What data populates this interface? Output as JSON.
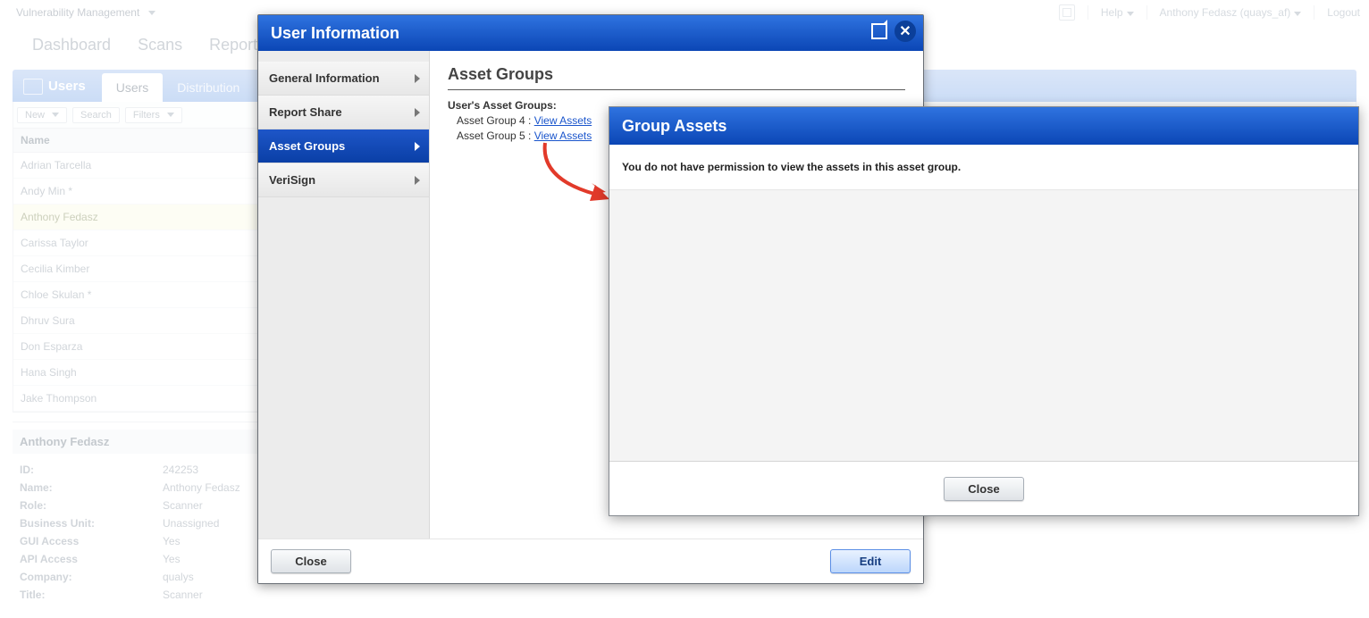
{
  "topbar": {
    "app_name": "Vulnerability Management",
    "help_label": "Help",
    "user_display": "Anthony Fedasz (quays_af)",
    "logout_label": "Logout"
  },
  "main_nav": {
    "items": [
      "Dashboard",
      "Scans",
      "Reports"
    ]
  },
  "users_panel": {
    "section_title": "Users",
    "tabs": [
      "Users",
      "Distribution"
    ],
    "active_tab": 0,
    "toolbar": {
      "new_label": "New",
      "search_label": "Search",
      "filters_label": "Filters"
    },
    "column_header": "Name",
    "rows": [
      "Adrian Tarcella",
      "Andy Min *",
      "Anthony Fedasz",
      "Carissa Taylor",
      "Cecilia Kimber",
      "Chloe Skulan *",
      "Dhruv Sura",
      "Don Esparza",
      "Hana Singh",
      "Jake Thompson"
    ],
    "selected_index": 2
  },
  "detail": {
    "header": "Anthony Fedasz",
    "rows": [
      {
        "k": "ID:",
        "v": "242253"
      },
      {
        "k": "Name:",
        "v": "Anthony Fedasz"
      },
      {
        "k": "Role:",
        "v": "Scanner"
      },
      {
        "k": "Business Unit:",
        "v": "Unassigned"
      },
      {
        "k": "GUI Access",
        "v": "Yes"
      },
      {
        "k": "API Access",
        "v": "Yes"
      },
      {
        "k": "Company:",
        "v": "qualys"
      },
      {
        "k": "Title:",
        "v": "Scanner"
      }
    ]
  },
  "dialog1": {
    "title": "User Information",
    "side_items": [
      "General Information",
      "Report Share",
      "Asset Groups",
      "VeriSign"
    ],
    "active_side_index": 2,
    "content": {
      "heading": "Asset Groups",
      "subheading": "User's Asset Groups:",
      "assets": [
        {
          "label": "Asset Group 4",
          "sep": " : ",
          "link": "View Assets"
        },
        {
          "label": "Asset Group 5",
          "sep": " : ",
          "link": "View Assets"
        }
      ]
    },
    "footer": {
      "close_label": "Close",
      "edit_label": "Edit"
    }
  },
  "dialog2": {
    "title": "Group Assets",
    "message": "You do not have permission to view the assets in this asset group.",
    "close_label": "Close"
  }
}
